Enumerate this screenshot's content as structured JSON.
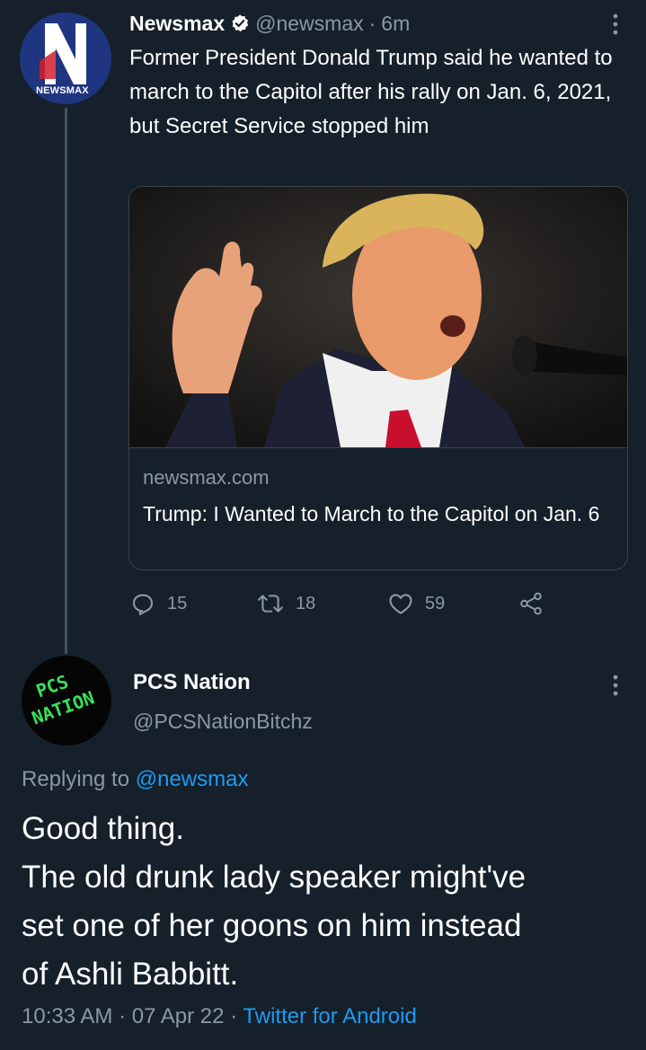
{
  "tweet": {
    "author_name": "Newsmax",
    "handle": "@newsmax",
    "separator": "·",
    "time_ago": "6m",
    "avatar_logo_text": "NEWSMAX",
    "avatar_letter": "N",
    "text": "Former President Donald Trump said he wanted to march to the Capitol after his rally on Jan. 6, 2021, but Secret Service stopped him",
    "card": {
      "domain": "newsmax.com",
      "title": "Trump: I Wanted to March to the Capitol on Jan. 6"
    },
    "actions": {
      "replies": "15",
      "retweets": "18",
      "likes": "59"
    }
  },
  "reply": {
    "author_name": "PCS Nation",
    "handle": "@PCSNationBitchz",
    "avatar_text_line1": "PCS",
    "avatar_text_line2": "NATION",
    "replying_prefix": "Replying to",
    "replying_to": "@newsmax",
    "text_lines": [
      "Good thing.",
      "The old drunk lady speaker might've",
      "set one of her goons on him instead",
      "of Ashli Babbitt."
    ],
    "time": "10:33 AM",
    "dot1": "·",
    "date": "07 Apr 22",
    "dot2": "·",
    "source": "Twitter for Android"
  },
  "colors": {
    "background": "#15202b",
    "secondary_text": "#8b98a5",
    "link": "#1d9bf0",
    "border": "#38444d"
  }
}
